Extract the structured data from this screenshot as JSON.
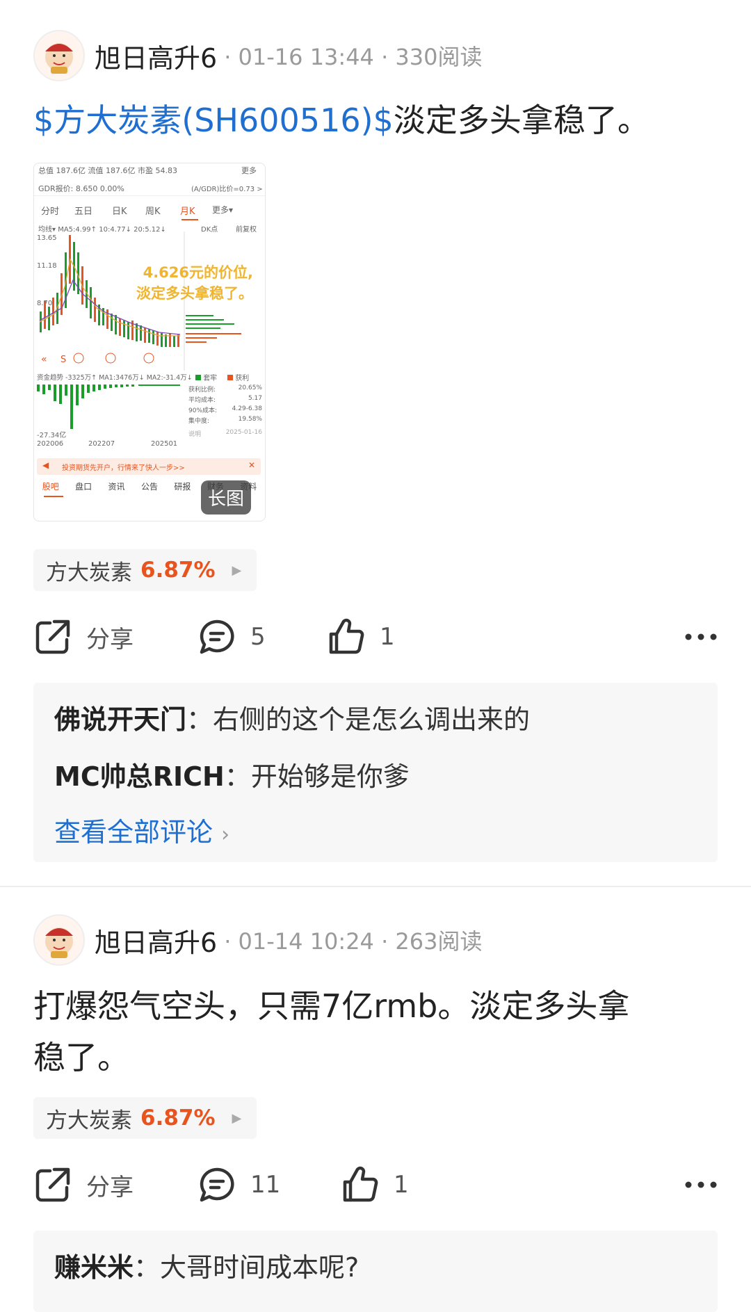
{
  "posts": [
    {
      "author": "旭日高升6",
      "meta": "· 01-16 13:44 · 330阅读",
      "stock_link": "$方大炭素(SH600516)$",
      "text": "淡定多头拿稳了。",
      "image": {
        "header_row1": "总值 187.6亿  流值 187.6亿  市盈 54.83",
        "header_more": "更多",
        "gdr": "GDR报价:  8.650  0.00%",
        "gdr_ratio": "(A/GDR)比价=0.73 >",
        "tabs": [
          "分时",
          "五日",
          "日K",
          "周K",
          "月K",
          "更多▾"
        ],
        "ma_line": "均线▾  MA5:4.99↑ 10:4.77↓ 20:5.12↓",
        "dk": "DK点",
        "fq": "前复权",
        "y_ticks": [
          "13.65",
          "11.18",
          "8.70"
        ],
        "overlay": [
          "4.626元的价位,",
          "淡定多头拿稳了。"
        ],
        "fund_flow": "资金趋势 -3325万↑ MA1:3476万↓ MA2:-31.4万↓",
        "fund_low": "-27.34亿",
        "x_ticks": [
          "202006",
          "202207",
          "202501"
        ],
        "legend": [
          "套牢",
          "获利"
        ],
        "stats": [
          [
            "获利比例:",
            "20.65%"
          ],
          [
            "平均成本:",
            "5.17"
          ],
          [
            "90%成本:",
            "4.29-6.38"
          ],
          [
            "集中度:",
            "19.58%"
          ]
        ],
        "stats_date": "2025-01-16",
        "stats_note": "说明",
        "ad": "投资期货先开户，行情来了快人一步>>",
        "bottom_tabs": [
          "股吧",
          "盘口",
          "资讯",
          "公告",
          "研报",
          "财务",
          "资料"
        ],
        "long_image_label": "长图"
      },
      "tag": {
        "name": "方大炭素",
        "pct": "6.87%"
      },
      "actions": {
        "share": "分享",
        "comments": "5",
        "likes": "1"
      },
      "comments": [
        {
          "name": "佛说开天门",
          "text": "右侧的这个是怎么调出来的"
        },
        {
          "name": "MC帅总RICH",
          "text": "开始够是你爹"
        }
      ],
      "view_all": "查看全部评论"
    },
    {
      "author": "旭日高升6",
      "meta": "· 01-14 10:24 · 263阅读",
      "text_line1": "打爆怨气空头，只需7亿rmb。淡定多头拿",
      "text_line2": "稳了。",
      "tag": {
        "name": "方大炭素",
        "pct": "6.87%"
      },
      "actions": {
        "share": "分享",
        "comments": "11",
        "likes": "1"
      },
      "comments": [
        {
          "name": "赚米米",
          "text": "大哥时间成本呢?"
        }
      ]
    }
  ],
  "colors": {
    "link": "#1f6fd1",
    "up": "#e8541e",
    "candle_green": "#1a9e2a",
    "overlay": "#f0b530"
  }
}
